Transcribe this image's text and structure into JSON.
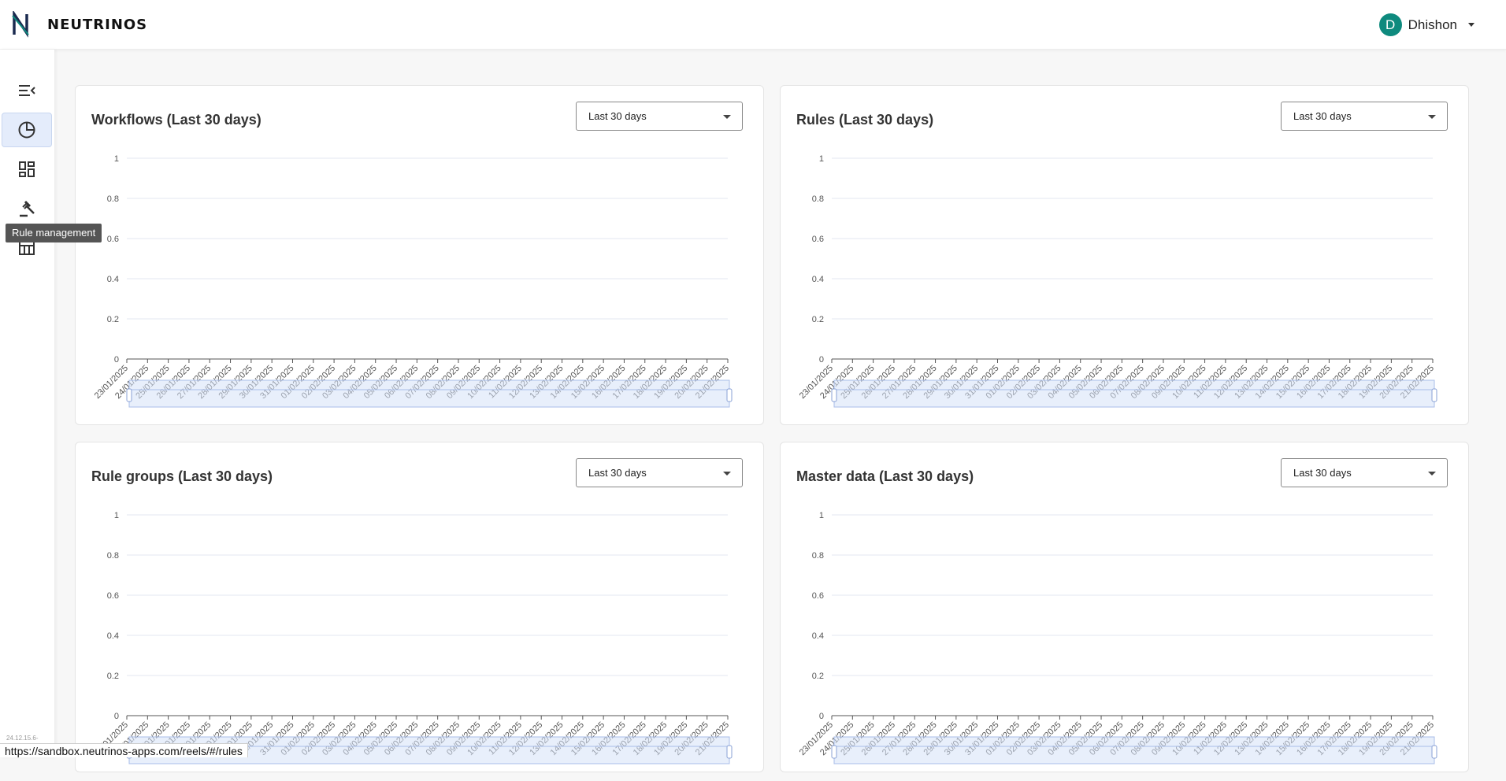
{
  "app": {
    "logo_text": "NEUTRINOS"
  },
  "user": {
    "initial": "D",
    "name": "Dhishon"
  },
  "sidebar": {
    "items": [
      {
        "name": "collapse-menu",
        "icon": "menu-collapse-icon"
      },
      {
        "name": "analytics",
        "icon": "pie-chart-icon",
        "active": true
      },
      {
        "name": "dashboard",
        "icon": "dashboard-icon"
      },
      {
        "name": "rule-management",
        "icon": "gavel-icon"
      },
      {
        "name": "master-data",
        "icon": "table-icon"
      }
    ],
    "tooltip": "Rule management",
    "version": "24.12.15.6-"
  },
  "status_url": "https://sandbox.neutrinos-apps.com/reels/#/rules",
  "cards": [
    {
      "title": "Workflows (Last 30 days)",
      "filter": "Last 30 days"
    },
    {
      "title": "Rules (Last 30 days)",
      "filter": "Last 30 days"
    },
    {
      "title": "Rule groups (Last 30 days)",
      "filter": "Last 30 days"
    },
    {
      "title": "Master data (Last 30 days)",
      "filter": "Last 30 days"
    }
  ],
  "chart_data": [
    {
      "type": "bar",
      "title": "Workflows (Last 30 days)",
      "categories": [
        "23/01/2025",
        "24/01/2025",
        "25/01/2025",
        "26/01/2025",
        "27/01/2025",
        "28/01/2025",
        "29/01/2025",
        "30/01/2025",
        "31/01/2025",
        "01/02/2025",
        "02/02/2025",
        "03/02/2025",
        "04/02/2025",
        "05/02/2025",
        "06/02/2025",
        "07/02/2025",
        "08/02/2025",
        "09/02/2025",
        "10/02/2025",
        "11/02/2025",
        "12/02/2025",
        "13/02/2025",
        "14/02/2025",
        "15/02/2025",
        "16/02/2025",
        "17/02/2025",
        "18/02/2025",
        "19/02/2025",
        "20/02/2025",
        "21/02/2025"
      ],
      "values": [
        0,
        0,
        0,
        0,
        0,
        0,
        0,
        0,
        0,
        0,
        0,
        0,
        0,
        0,
        0,
        0,
        0,
        0,
        0,
        0,
        0,
        0,
        0,
        0,
        0,
        0,
        0,
        0,
        0,
        0
      ],
      "yticks": [
        "0",
        "0.2",
        "0.4",
        "0.6",
        "0.8",
        "1"
      ],
      "ylim": [
        0,
        1
      ],
      "grid": true
    },
    {
      "type": "bar",
      "title": "Rules (Last 30 days)",
      "categories": [
        "23/01/2025",
        "24/01/2025",
        "25/01/2025",
        "26/01/2025",
        "27/01/2025",
        "28/01/2025",
        "29/01/2025",
        "30/01/2025",
        "31/01/2025",
        "01/02/2025",
        "02/02/2025",
        "03/02/2025",
        "04/02/2025",
        "05/02/2025",
        "06/02/2025",
        "07/02/2025",
        "08/02/2025",
        "09/02/2025",
        "10/02/2025",
        "11/02/2025",
        "12/02/2025",
        "13/02/2025",
        "14/02/2025",
        "15/02/2025",
        "16/02/2025",
        "17/02/2025",
        "18/02/2025",
        "19/02/2025",
        "20/02/2025",
        "21/02/2025"
      ],
      "values": [
        0,
        0,
        0,
        0,
        0,
        0,
        0,
        0,
        0,
        0,
        0,
        0,
        0,
        0,
        0,
        0,
        0,
        0,
        0,
        0,
        0,
        0,
        0,
        0,
        0,
        0,
        0,
        0,
        0,
        0
      ],
      "yticks": [
        "0",
        "0.2",
        "0.4",
        "0.6",
        "0.8",
        "1"
      ],
      "ylim": [
        0,
        1
      ],
      "grid": true
    },
    {
      "type": "bar",
      "title": "Rule groups (Last 30 days)",
      "categories": [
        "23/01/2025",
        "24/01/2025",
        "25/01/2025",
        "26/01/2025",
        "27/01/2025",
        "28/01/2025",
        "29/01/2025",
        "30/01/2025",
        "31/01/2025",
        "01/02/2025",
        "02/02/2025",
        "03/02/2025",
        "04/02/2025",
        "05/02/2025",
        "06/02/2025",
        "07/02/2025",
        "08/02/2025",
        "09/02/2025",
        "10/02/2025",
        "11/02/2025",
        "12/02/2025",
        "13/02/2025",
        "14/02/2025",
        "15/02/2025",
        "16/02/2025",
        "17/02/2025",
        "18/02/2025",
        "19/02/2025",
        "20/02/2025",
        "21/02/2025"
      ],
      "values": [
        0,
        0,
        0,
        0,
        0,
        0,
        0,
        0,
        0,
        0,
        0,
        0,
        0,
        0,
        0,
        0,
        0,
        0,
        0,
        0,
        0,
        0,
        0,
        0,
        0,
        0,
        0,
        0,
        0,
        0
      ],
      "yticks": [
        "0",
        "0.2",
        "0.4",
        "0.6",
        "0.8",
        "1"
      ],
      "ylim": [
        0,
        1
      ],
      "grid": true
    },
    {
      "type": "bar",
      "title": "Master data (Last 30 days)",
      "categories": [
        "23/01/2025",
        "24/01/2025",
        "25/01/2025",
        "26/01/2025",
        "27/01/2025",
        "28/01/2025",
        "29/01/2025",
        "30/01/2025",
        "31/01/2025",
        "01/02/2025",
        "02/02/2025",
        "03/02/2025",
        "04/02/2025",
        "05/02/2025",
        "06/02/2025",
        "07/02/2025",
        "08/02/2025",
        "09/02/2025",
        "10/02/2025",
        "11/02/2025",
        "12/02/2025",
        "13/02/2025",
        "14/02/2025",
        "15/02/2025",
        "16/02/2025",
        "17/02/2025",
        "18/02/2025",
        "19/02/2025",
        "20/02/2025",
        "21/02/2025"
      ],
      "values": [
        0,
        0,
        0,
        0,
        0,
        0,
        0,
        0,
        0,
        0,
        0,
        0,
        0,
        0,
        0,
        0,
        0,
        0,
        0,
        0,
        0,
        0,
        0,
        0,
        0,
        0,
        0,
        0,
        0,
        0
      ],
      "yticks": [
        "0",
        "0.2",
        "0.4",
        "0.6",
        "0.8",
        "1"
      ],
      "ylim": [
        0,
        1
      ],
      "grid": true
    }
  ],
  "colors": {
    "accent": "#0e8a7e",
    "grid": "#e3e7f1",
    "zoom_fill": "#d5e1f7",
    "zoom_border": "#a9bde8"
  }
}
